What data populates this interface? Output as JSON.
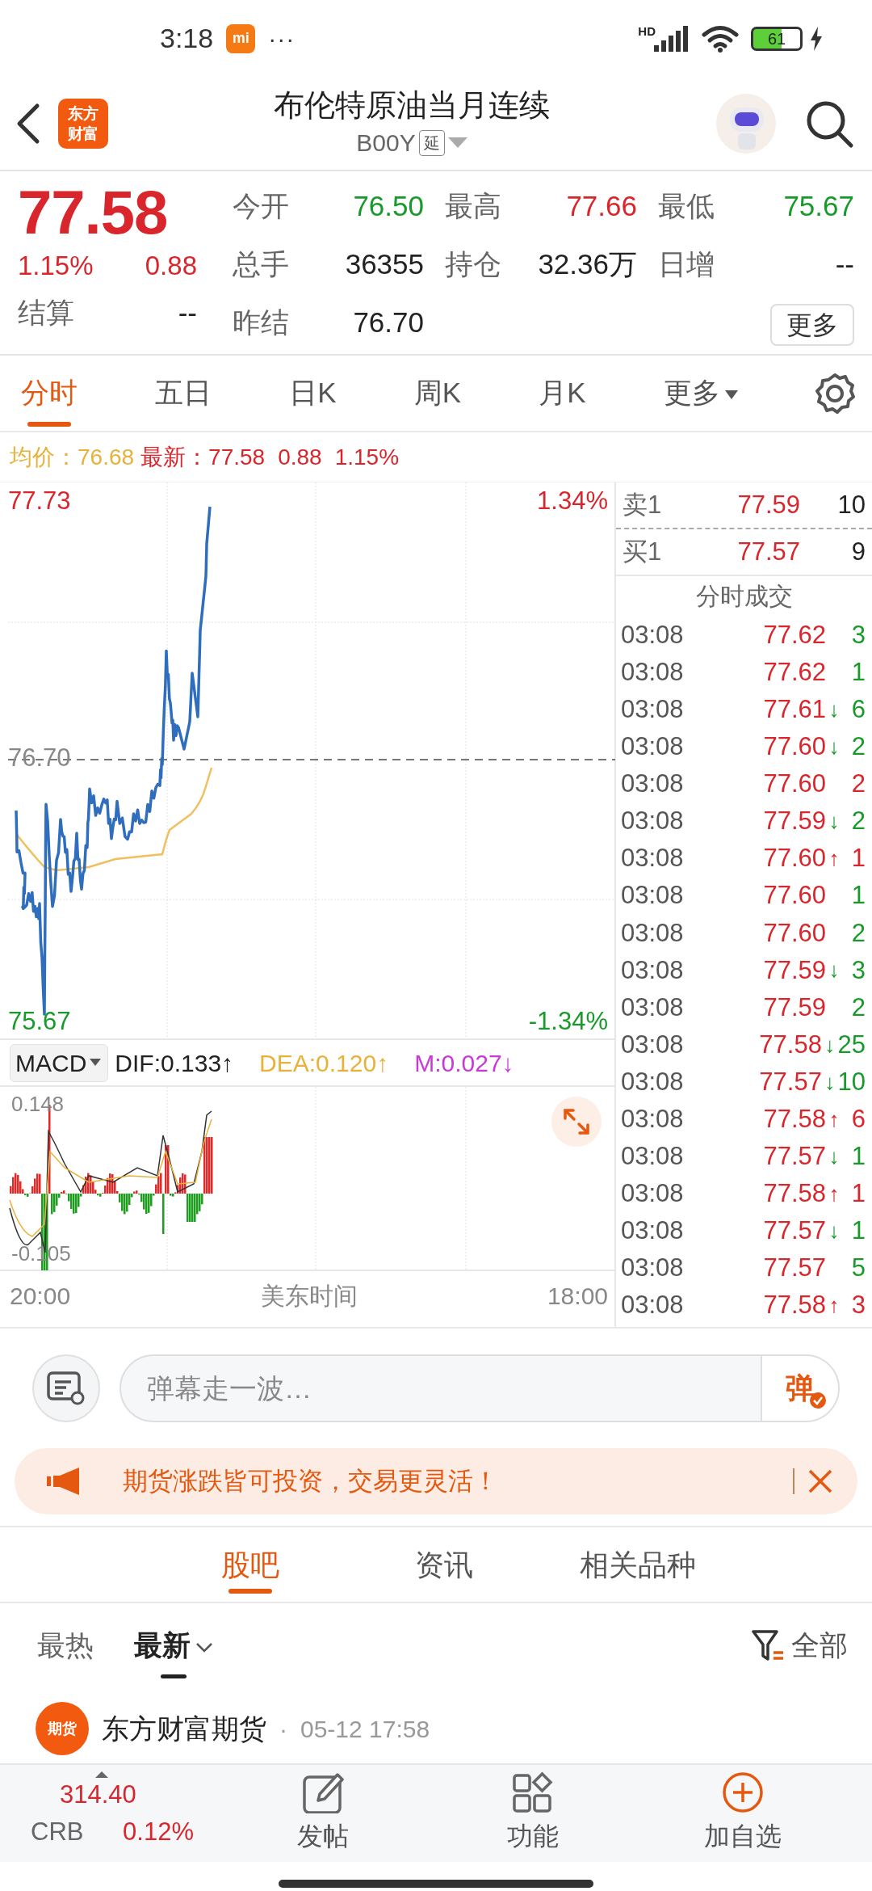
{
  "status_bar": {
    "time": "3:18",
    "app_badge": "mi",
    "more": "···",
    "network": "HD",
    "battery": "61"
  },
  "header": {
    "logo": [
      "东方",
      "财富"
    ],
    "title": "布伦特原油当月连续",
    "code": "B00Y",
    "tag": "延"
  },
  "quote": {
    "price": "77.58",
    "change_pct": "1.15%",
    "change": "0.88",
    "settle_label": "结算",
    "settle_value": "--",
    "stats": [
      {
        "label": "今开",
        "value": "76.50",
        "color": "#189a2b"
      },
      {
        "label": "最高",
        "value": "77.66",
        "color": "#d9262c"
      },
      {
        "label": "最低",
        "value": "75.67",
        "color": "#189a2b"
      },
      {
        "label": "总手",
        "value": "36355",
        "color": "#222222"
      },
      {
        "label": "持仓",
        "value": "32.36万",
        "color": "#222222"
      },
      {
        "label": "日增",
        "value": "--",
        "color": "#222222"
      },
      {
        "label": "昨结",
        "value": "76.70",
        "color": "#222222"
      }
    ],
    "more_button": "更多"
  },
  "chart_tabs": [
    {
      "label": "分时",
      "selected": true,
      "kind": "tab"
    },
    {
      "label": "五日",
      "selected": false,
      "kind": "tab"
    },
    {
      "label": "日K",
      "selected": false,
      "kind": "tab"
    },
    {
      "label": "周K",
      "selected": false,
      "kind": "tab"
    },
    {
      "label": "月K",
      "selected": false,
      "kind": "tab"
    },
    {
      "label": "更多",
      "selected": false,
      "kind": "dropdown"
    }
  ],
  "summary": {
    "avg_label": "均价：",
    "avg": "76.68",
    "last_label": "最新：",
    "last": "77.58",
    "change": "0.88",
    "change_pct": "1.15%"
  },
  "chart": {
    "y_max": "77.73",
    "y_mid": "76.70",
    "y_min": "75.67",
    "pct_max": "1.34%",
    "pct_min": "-1.34%",
    "indicator": "MACD",
    "dif": "DIF:0.133↑",
    "dea": "DEA:0.120↑",
    "m": "M:0.027↓",
    "macd_max": "0.148",
    "macd_min": "-0.105",
    "x_start": "20:00",
    "x_label": "美东时间",
    "x_end": "18:00"
  },
  "order_book": [
    {
      "side": "卖1",
      "price": "77.59",
      "volume": "10"
    },
    {
      "side": "买1",
      "price": "77.57",
      "volume": "9"
    }
  ],
  "trades_title": "分时成交",
  "trades": [
    {
      "time": "03:08",
      "price": "77.62",
      "volume": "3",
      "color": "#189a2b"
    },
    {
      "time": "03:08",
      "price": "77.62",
      "volume": "1",
      "color": "#189a2b"
    },
    {
      "time": "03:08",
      "price": "77.61",
      "arrow": {
        "symbol": "↓",
        "color": "#189a2b"
      },
      "volume": "6",
      "color": "#189a2b"
    },
    {
      "time": "03:08",
      "price": "77.60",
      "arrow": {
        "symbol": "↓",
        "color": "#189a2b"
      },
      "volume": "2",
      "color": "#189a2b"
    },
    {
      "time": "03:08",
      "price": "77.60",
      "volume": "2",
      "color": "#d9262c"
    },
    {
      "time": "03:08",
      "price": "77.59",
      "arrow": {
        "symbol": "↓",
        "color": "#189a2b"
      },
      "volume": "2",
      "color": "#189a2b"
    },
    {
      "time": "03:08",
      "price": "77.60",
      "arrow": {
        "symbol": "↑",
        "color": "#d9262c"
      },
      "volume": "1",
      "color": "#d9262c"
    },
    {
      "time": "03:08",
      "price": "77.60",
      "volume": "1",
      "color": "#189a2b"
    },
    {
      "time": "03:08",
      "price": "77.60",
      "volume": "2",
      "color": "#189a2b"
    },
    {
      "time": "03:08",
      "price": "77.59",
      "arrow": {
        "symbol": "↓",
        "color": "#189a2b"
      },
      "volume": "3",
      "color": "#189a2b"
    },
    {
      "time": "03:08",
      "price": "77.59",
      "volume": "2",
      "color": "#189a2b"
    },
    {
      "time": "03:08",
      "price": "77.58",
      "arrow": {
        "symbol": "↓",
        "color": "#189a2b"
      },
      "volume": "25",
      "color": "#189a2b"
    },
    {
      "time": "03:08",
      "price": "77.57",
      "arrow": {
        "symbol": "↓",
        "color": "#189a2b"
      },
      "volume": "10",
      "color": "#189a2b"
    },
    {
      "time": "03:08",
      "price": "77.58",
      "arrow": {
        "symbol": "↑",
        "color": "#d9262c"
      },
      "volume": "6",
      "color": "#d9262c"
    },
    {
      "time": "03:08",
      "price": "77.57",
      "arrow": {
        "symbol": "↓",
        "color": "#189a2b"
      },
      "volume": "1",
      "color": "#189a2b"
    },
    {
      "time": "03:08",
      "price": "77.58",
      "arrow": {
        "symbol": "↑",
        "color": "#d9262c"
      },
      "volume": "1",
      "color": "#d9262c"
    },
    {
      "time": "03:08",
      "price": "77.57",
      "arrow": {
        "symbol": "↓",
        "color": "#189a2b"
      },
      "volume": "1",
      "color": "#189a2b"
    },
    {
      "time": "03:08",
      "price": "77.57",
      "volume": "5",
      "color": "#189a2b"
    },
    {
      "time": "03:08",
      "price": "77.58",
      "arrow": {
        "symbol": "↑",
        "color": "#d9262c"
      },
      "volume": "3",
      "color": "#d9262c"
    }
  ],
  "danmu": {
    "placeholder": "弹幕走一波…",
    "send": "弹"
  },
  "notice": {
    "text": "期货涨跌皆可投资，交易更灵活！"
  },
  "section_tabs": [
    {
      "label": "股吧",
      "selected": true
    },
    {
      "label": "资讯",
      "selected": false
    },
    {
      "label": "相关品种",
      "selected": false
    }
  ],
  "sort_tabs": [
    {
      "label": "最热",
      "selected": false,
      "kind": "plain"
    },
    {
      "label": "最新",
      "selected": true,
      "kind": "dropdown"
    }
  ],
  "filter": "全部",
  "post": {
    "avatar": "期货",
    "author": "东方财富期货",
    "separator": "·",
    "time": "05-12 17:58"
  },
  "bottom_bar": {
    "index_value": "314.40",
    "index_name": "CRB",
    "index_change": "0.12%",
    "actions": [
      {
        "label": "发帖",
        "kind": "post"
      },
      {
        "label": "功能",
        "kind": "apps"
      },
      {
        "label": "加自选",
        "kind": "add"
      }
    ]
  }
}
